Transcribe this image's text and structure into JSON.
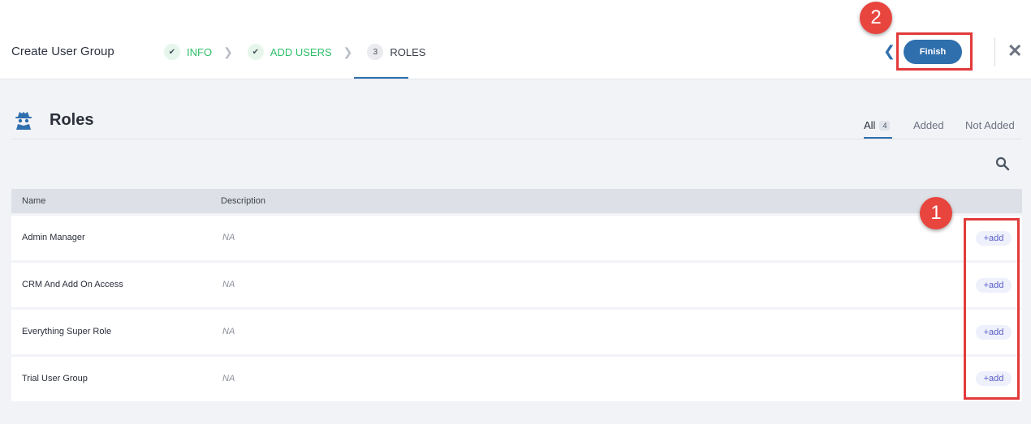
{
  "header": {
    "title": "Create User Group",
    "steps": [
      {
        "label": "INFO",
        "status": "done",
        "marker": "✔"
      },
      {
        "label": "ADD USERS",
        "status": "done",
        "marker": "✔"
      },
      {
        "label": "ROLES",
        "status": "current",
        "marker": "3"
      }
    ],
    "finish_label": "Finish"
  },
  "callouts": {
    "one": "1",
    "two": "2"
  },
  "roles": {
    "title": "Roles",
    "filters": {
      "all": "All",
      "all_count": "4",
      "added": "Added",
      "not_added": "Not Added"
    },
    "columns": {
      "name": "Name",
      "description": "Description"
    },
    "rows": [
      {
        "name": "Admin Manager",
        "description": "NA",
        "action": "+add"
      },
      {
        "name": "CRM And Add On Access",
        "description": "NA",
        "action": "+add"
      },
      {
        "name": "Everything Super Role",
        "description": "NA",
        "action": "+add"
      },
      {
        "name": "Trial User Group",
        "description": "NA",
        "action": "+add"
      }
    ]
  },
  "colors": {
    "accent": "#2f6fad",
    "success": "#2fbf6a",
    "callout": "#e23a3a",
    "add_text": "#5b5fc7"
  }
}
